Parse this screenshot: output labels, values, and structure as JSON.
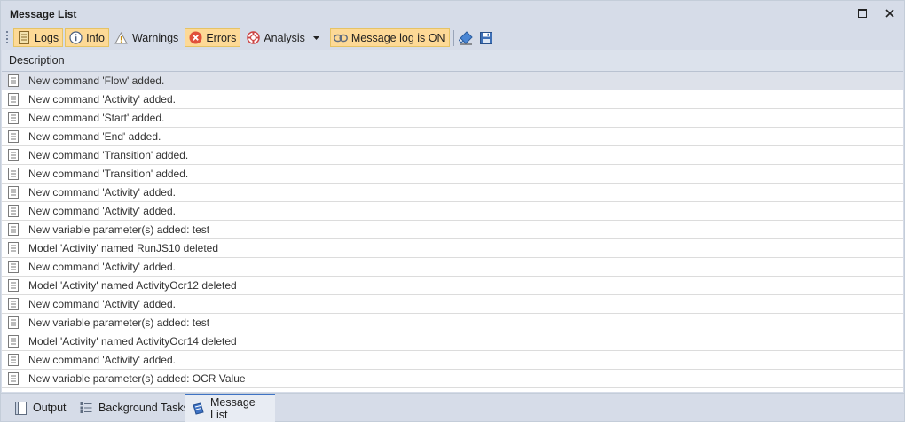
{
  "window": {
    "title": "Message List"
  },
  "toolbar": {
    "logs_label": "Logs",
    "info_label": "Info",
    "warnings_label": "Warnings",
    "errors_label": "Errors",
    "analysis_label": "Analysis",
    "message_log_label": "Message log is ON"
  },
  "table": {
    "column_header": "Description",
    "rows": [
      "New command 'Flow' added.",
      "New command 'Activity' added.",
      "New command 'Start' added.",
      "New command 'End' added.",
      "New command 'Transition' added.",
      "New command 'Transition' added.",
      "New command 'Activity' added.",
      "New command 'Activity' added.",
      "New variable parameter(s) added: test",
      "Model 'Activity' named RunJS10 deleted",
      "New command 'Activity' added.",
      "Model 'Activity' named ActivityOcr12 deleted",
      "New command 'Activity' added.",
      "New variable parameter(s) added: test",
      "Model 'Activity' named ActivityOcr14 deleted",
      "New command 'Activity' added.",
      "New variable parameter(s) added: OCR Value"
    ]
  },
  "tabs": {
    "output_label": "Output",
    "background_tasks_label": "Background Tasks",
    "message_list_label": "Message List"
  },
  "colors": {
    "active_button": "#fdd996",
    "selected_row": "#dde1ea",
    "active_tab_accent": "#3f73c4"
  }
}
